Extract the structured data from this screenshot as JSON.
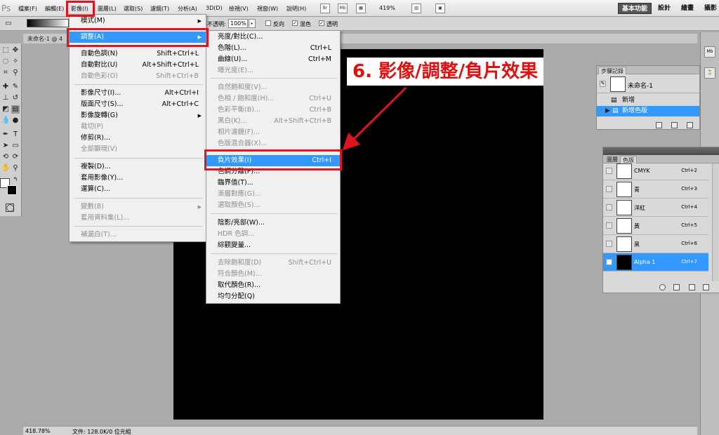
{
  "app": {
    "logo": "Ps"
  },
  "menubar": {
    "items": [
      "檔案(F)",
      "編輯(E)",
      "影像(I)",
      "圖層(L)",
      "選取(S)",
      "濾鏡(T)",
      "分析(A)",
      "3D(D)",
      "檢視(V)",
      "視窗(W)",
      "說明(H)"
    ],
    "toolbar_icons": [
      "Br",
      "Mb"
    ],
    "zoom": "419%",
    "workspaces": [
      "基本功能",
      "設計",
      "繪畫",
      "攝影"
    ]
  },
  "options": {
    "opacity_label": "不透明:",
    "opacity_value": "100%",
    "reverse_label": "反向",
    "dither_label": "混色",
    "transparency_label": "透明"
  },
  "document": {
    "tab": "未命名-1 @ 4",
    "zoom": "418.78%",
    "file_info": "文件: 128.0K/0 位元組"
  },
  "annotation": "6. 影像/調整/負片效果",
  "image_menu": [
    {
      "label": "模式(M)",
      "shortcut": "",
      "submenu": true,
      "disabled": false
    },
    {
      "label": "調整(A)",
      "shortcut": "",
      "submenu": true,
      "disabled": false,
      "selected": true
    },
    {
      "label": "自動色調(N)",
      "shortcut": "Shift+Ctrl+L",
      "disabled": false
    },
    {
      "label": "自動對比(U)",
      "shortcut": "Alt+Shift+Ctrl+L",
      "disabled": false
    },
    {
      "label": "自動色彩(O)",
      "shortcut": "Shift+Ctrl+B",
      "disabled": true
    },
    {
      "label": "影像尺寸(I)...",
      "shortcut": "Alt+Ctrl+I",
      "disabled": false
    },
    {
      "label": "版面尺寸(S)...",
      "shortcut": "Alt+Ctrl+C",
      "disabled": false
    },
    {
      "label": "影像旋轉(G)",
      "shortcut": "",
      "submenu": true,
      "disabled": false
    },
    {
      "label": "裁切(P)",
      "shortcut": "",
      "disabled": true
    },
    {
      "label": "修剪(R)...",
      "shortcut": "",
      "disabled": false
    },
    {
      "label": "全部顯現(V)",
      "shortcut": "",
      "disabled": true
    },
    {
      "label": "複製(D)...",
      "shortcut": "",
      "disabled": false
    },
    {
      "label": "套用影像(Y)...",
      "shortcut": "",
      "disabled": false
    },
    {
      "label": "運算(C)...",
      "shortcut": "",
      "disabled": false
    },
    {
      "label": "變數(B)",
      "shortcut": "",
      "submenu": true,
      "disabled": true
    },
    {
      "label": "套用資料集(L)...",
      "shortcut": "",
      "disabled": true
    },
    {
      "label": "補漏白(T)...",
      "shortcut": "",
      "disabled": true
    }
  ],
  "adjust_menu": [
    {
      "label": "亮度/對比(C)...",
      "shortcut": "",
      "disabled": false
    },
    {
      "label": "色階(L)...",
      "shortcut": "Ctrl+L",
      "disabled": false
    },
    {
      "label": "曲線(U)...",
      "shortcut": "Ctrl+M",
      "disabled": false
    },
    {
      "label": "曝光度(E)...",
      "shortcut": "",
      "disabled": true
    },
    {
      "label": "自然飽和度(V)...",
      "shortcut": "",
      "disabled": true
    },
    {
      "label": "色相 / 飽和度(H)...",
      "shortcut": "Ctrl+U",
      "disabled": true
    },
    {
      "label": "色彩平衡(B)...",
      "shortcut": "Ctrl+B",
      "disabled": true
    },
    {
      "label": "黑白(K)...",
      "shortcut": "Alt+Shift+Ctrl+B",
      "disabled": true
    },
    {
      "label": "相片濾鏡(F)...",
      "shortcut": "",
      "disabled": true
    },
    {
      "label": "色版混合器(X)...",
      "shortcut": "",
      "disabled": true
    },
    {
      "label": "負片效果(I)",
      "shortcut": "Ctrl+I",
      "disabled": false,
      "selected": true
    },
    {
      "label": "色調分離(P)...",
      "shortcut": "",
      "disabled": false
    },
    {
      "label": "臨界值(T)...",
      "shortcut": "",
      "disabled": false
    },
    {
      "label": "漸層對應(G)...",
      "shortcut": "",
      "disabled": true
    },
    {
      "label": "選取顏色(S)...",
      "shortcut": "",
      "disabled": true
    },
    {
      "label": "陰影/亮部(W)...",
      "shortcut": "",
      "disabled": false
    },
    {
      "label": "HDR 色調...",
      "shortcut": "",
      "disabled": true
    },
    {
      "label": "綜觀變量...",
      "shortcut": "",
      "disabled": false
    },
    {
      "label": "去除飽和度(D)",
      "shortcut": "Shift+Ctrl+U",
      "disabled": true
    },
    {
      "label": "符合顏色(M)...",
      "shortcut": "",
      "disabled": true
    },
    {
      "label": "取代顏色(R)...",
      "shortcut": "",
      "disabled": false
    },
    {
      "label": "均勻分配(Q)",
      "shortcut": "",
      "disabled": false
    }
  ],
  "history_panel": {
    "tab": "步驟記錄",
    "snapshot": "未命名-1",
    "items": [
      "新增",
      "新增色版"
    ]
  },
  "channels_panel": {
    "tabs": [
      "圖層",
      "色版"
    ],
    "channels": [
      {
        "name": "CMYK",
        "shortcut": "Ctrl+2",
        "visible": false,
        "dark": false
      },
      {
        "name": "青",
        "shortcut": "Ctrl+3",
        "visible": false,
        "dark": false
      },
      {
        "name": "洋紅",
        "shortcut": "Ctrl+4",
        "visible": false,
        "dark": false
      },
      {
        "name": "黃",
        "shortcut": "Ctrl+5",
        "visible": false,
        "dark": false
      },
      {
        "name": "黑",
        "shortcut": "Ctrl+6",
        "visible": false,
        "dark": false
      },
      {
        "name": "Alpha 1",
        "shortcut": "Ctrl+7",
        "visible": true,
        "dark": true,
        "selected": true
      }
    ]
  },
  "colors": {
    "highlight": "#3399ff",
    "annotation_red": "#e0141e",
    "canvas": "#000000"
  }
}
